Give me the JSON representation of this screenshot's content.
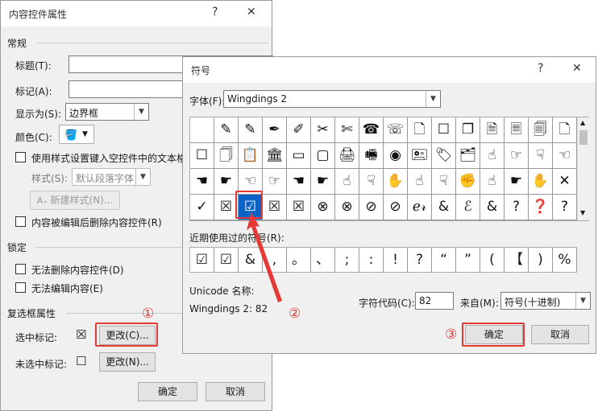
{
  "left_dialog": {
    "title": "内容控件属性",
    "help": "?",
    "close": "✕",
    "general_section": "常规",
    "title_label": "标题(T):",
    "tag_label": "标记(A):",
    "show_as_label": "显示为(S):",
    "show_as_value": "边界框",
    "color_label": "颜色(C):",
    "use_style_label": "使用样式设置键入空控件中的文本格",
    "style_label": "样式(S):",
    "style_value": "默认段落字体",
    "new_style_button": "新建样式(N)...",
    "remove_on_edit_label": "内容被编辑后删除内容控件(R)",
    "lock_section": "锁定",
    "no_delete_label": "无法删除内容控件(D)",
    "no_edit_label": "无法编辑内容(E)",
    "checkbox_section": "复选框属性",
    "checked_symbol_label": "选中标记:",
    "checked_symbol": "☒",
    "change_checked_button": "更改(C)...",
    "unchecked_symbol_label": "未选中标记:",
    "unchecked_symbol": "☐",
    "change_unchecked_button": "更改(N)...",
    "ok_button": "确定",
    "cancel_button": "取消"
  },
  "symbol_dialog": {
    "title": "符号",
    "help": "?",
    "close": "✕",
    "font_label": "字体(F):",
    "font_value": "Wingdings 2",
    "recent_label": "近期使用过的符号(R):",
    "unicode_name_label": "Unicode 名称:",
    "symbol_name": "Wingdings 2: 82",
    "char_code_label": "字符代码(C):",
    "char_code_value": "82",
    "from_label": "来自(M):",
    "from_value": "符号(十进制)",
    "ok_button": "确定",
    "cancel_button": "取消"
  },
  "grid_symbols": [
    [
      "",
      "✎",
      "✎",
      "✒",
      "✐",
      "✂",
      "✄",
      "☎",
      "☏",
      "🗋",
      "☐",
      "❐",
      "🗎",
      "🗏",
      "🗐",
      "🗋"
    ],
    [
      "☐",
      "🗍",
      "📋",
      "🏛",
      "▭",
      "▢",
      "🖨",
      "🖷",
      "◉",
      "🖭",
      "🏷",
      "🗂",
      "☝",
      "☞",
      "☟",
      "☜"
    ],
    [
      "☚",
      "☛",
      "☜",
      "☞",
      "☚",
      "☛",
      "☝",
      "☟",
      "✋",
      "☝",
      "☟",
      "✊",
      "☝",
      "☛",
      "✋",
      "✕"
    ],
    [
      "✓",
      "☒",
      "☑",
      "☒",
      "☒",
      "⊗",
      "⊗",
      "⊘",
      "⊘",
      "ℯ𝓇",
      "&",
      "ℰ",
      "&",
      "?",
      "❓",
      "?"
    ]
  ],
  "recent_symbols": [
    "☑",
    "☑",
    "&",
    ",",
    "。",
    "、",
    ";",
    ":",
    "!",
    "?",
    "“",
    "”",
    "(",
    "【",
    ")",
    "%"
  ],
  "annotations": {
    "step1": "①",
    "step2": "②",
    "step3": "③"
  }
}
